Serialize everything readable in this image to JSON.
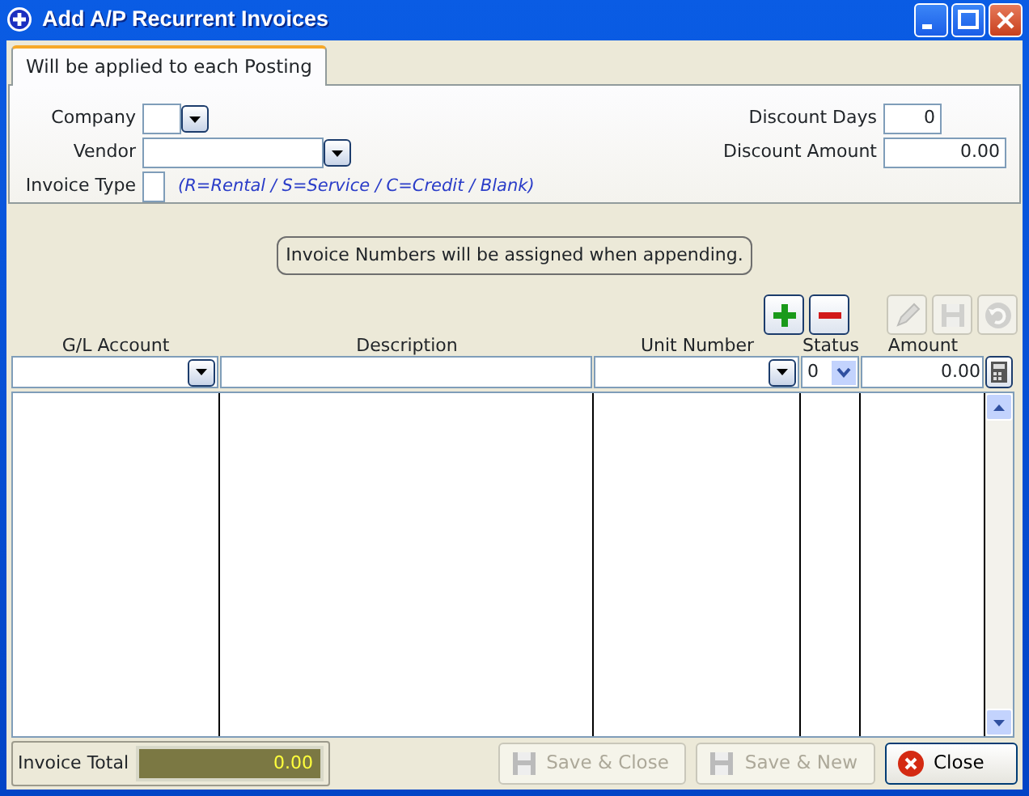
{
  "window": {
    "title": "Add A/P Recurrent Invoices"
  },
  "tabs": [
    {
      "label": "Will be applied to each Posting",
      "selected": true
    }
  ],
  "header_fields": [
    {
      "label": "Company",
      "kind": "combo"
    },
    {
      "label": "Vendor",
      "kind": "combo"
    },
    {
      "label": "Invoice Type",
      "kind": "text",
      "hint": "(R=Rental / S=Service / C=Credit / Blank)"
    }
  ],
  "discount_fields": [
    {
      "label": "Discount Days",
      "value": "0"
    },
    {
      "label": "Discount Amount",
      "value": "0.00"
    }
  ],
  "notice": "Invoice Numbers will be assigned when appending.",
  "toolbar": [
    {
      "kind": "add",
      "disabled": false
    },
    {
      "kind": "remove",
      "disabled": false
    },
    {
      "kind": "edit",
      "disabled": true
    },
    {
      "kind": "save",
      "disabled": true
    },
    {
      "kind": "undo",
      "disabled": true
    }
  ],
  "table": {
    "columns": [
      {
        "heading": "G/L Account",
        "kind": "combo"
      },
      {
        "heading": "Description",
        "kind": "text"
      },
      {
        "heading": "Unit Number",
        "kind": "combo"
      },
      {
        "heading": "Status",
        "kind": "select",
        "value": "0"
      },
      {
        "heading": "Amount",
        "kind": "number",
        "value": "0.00"
      }
    ]
  },
  "invoice_total": {
    "label": "Invoice Total",
    "value": "0.00"
  },
  "buttons": [
    {
      "label": "Save & Close",
      "kind": "save",
      "disabled": true
    },
    {
      "label": "Save & New",
      "kind": "save",
      "disabled": true
    },
    {
      "label": "Close",
      "kind": "close",
      "disabled": false
    }
  ]
}
